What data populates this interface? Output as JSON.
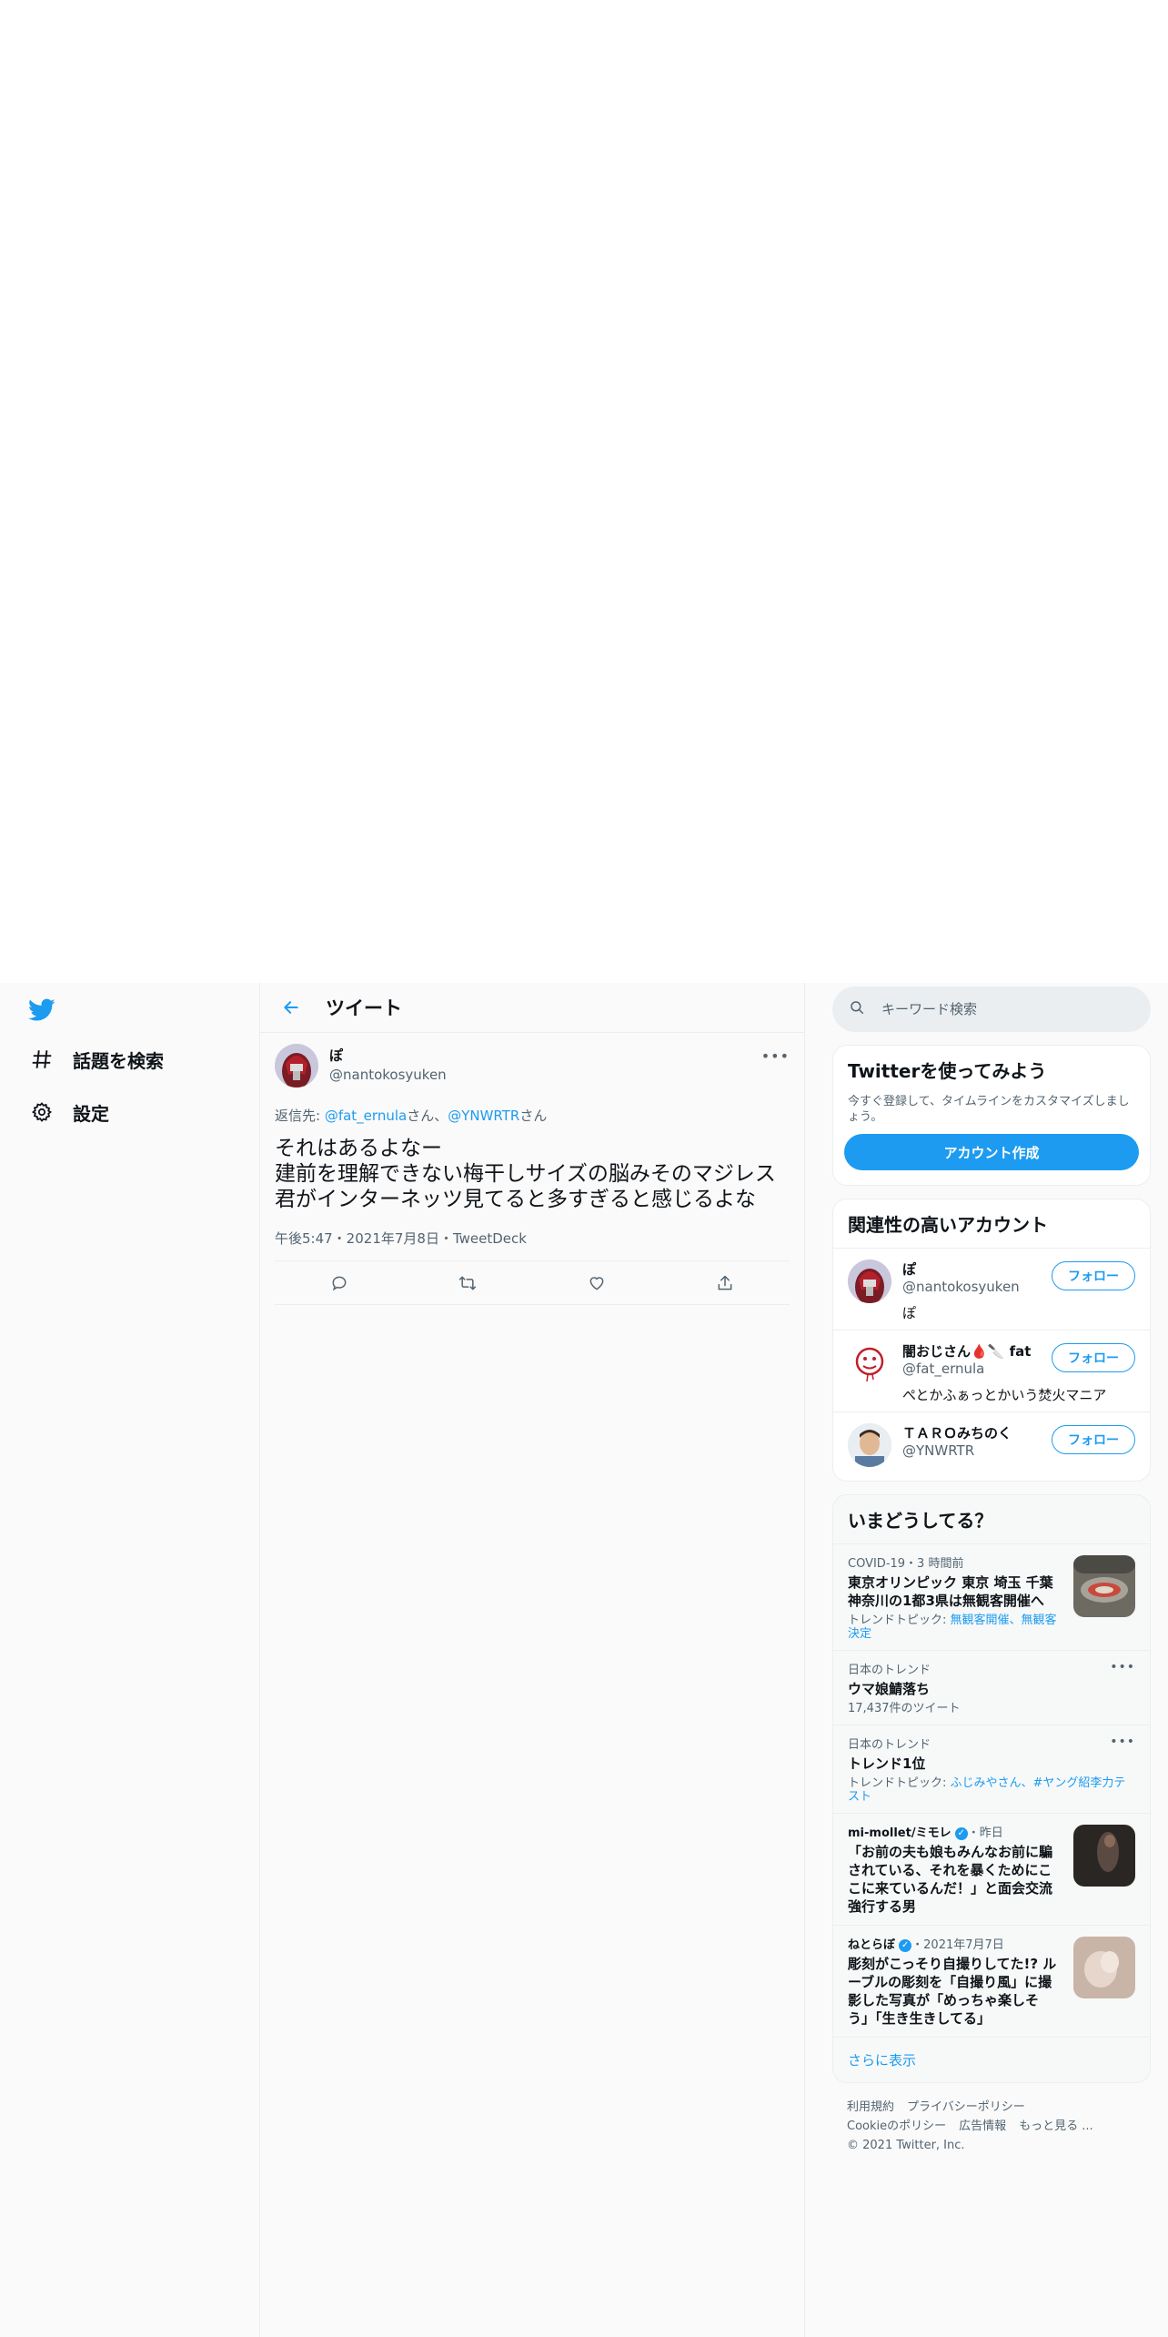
{
  "nav": {
    "explore_label": "話題を検索",
    "settings_label": "設定"
  },
  "header": {
    "title": "ツイート"
  },
  "tweet": {
    "name": "ぽ",
    "handle": "@nantokosyuken",
    "reply_prefix": "返信先: ",
    "reply_user1": "@fat_ernula",
    "reply_sep1": "さん、",
    "reply_user2": "@YNWRTR",
    "reply_sep2": "さん",
    "text": "それはあるよなー\n建前を理解できない梅干しサイズの脳みそのマジレス君がインターネッツ見てると多すぎると感じるよな",
    "meta": "午後5:47・2021年7月8日・TweetDeck"
  },
  "search": {
    "placeholder": "キーワード検索"
  },
  "signup": {
    "title": "Twitterを使ってみよう",
    "description": "今すぐ登録して、タイムラインをカスタマイズしましょう。",
    "button": "アカウント作成"
  },
  "related": {
    "title": "関連性の高いアカウント",
    "follow_label": "フォロー",
    "accounts": [
      {
        "name": "ぽ",
        "handle": "@nantokosyuken",
        "bio": "ぽ"
      },
      {
        "name": "闇おじさん🩸🔪 fat",
        "handle": "@fat_ernula",
        "bio": "ぺとかふぁっとかいう焚火マニア"
      },
      {
        "name": "ＴＡＲＯみちのく",
        "handle": "@YNWRTR",
        "bio": ""
      }
    ]
  },
  "trends": {
    "title": "いまどうしてる？",
    "items": [
      {
        "context": "COVID-19・3 時間前",
        "title": "東京オリンピック 東京 埼玉 千葉 神奈川の1都3県は無観客開催へ",
        "sub_prefix": "トレンドトピック: ",
        "sub_links": "無観客開催、無観客決定"
      },
      {
        "context": "日本のトレンド",
        "title": "ウマ娘鯖落ち",
        "sub": "17,437件のツイート"
      },
      {
        "context": "日本のトレンド",
        "title": "トレンド1位",
        "sub_prefix": "トレンドトピック: ",
        "sub_links": "ふじみやさん、#ヤング紹李力テスト"
      },
      {
        "source": "mi-mollet/ミモレ",
        "time": "・昨日",
        "title": "「お前の夫も娘もみんなお前に騙されている、それを暴くためにここに来ているんだ！」と面会交流強行する男"
      },
      {
        "source": "ねとらぼ",
        "time": "・2021年7月7日",
        "title": "彫刻がこっそり自撮りしてた!? ルーブルの彫刻を「自撮り風」に撮影した写真が「めっちゃ楽しそう」「生き生きしてる」"
      }
    ],
    "show_more": "さらに表示"
  },
  "footer": {
    "terms": "利用規約",
    "privacy": "プライバシーポリシー",
    "cookies": "Cookieのポリシー",
    "ads": "広告情報",
    "more": "もっと見る ...",
    "copyright": "© 2021 Twitter, Inc."
  },
  "colors": {
    "accent": "#1d9bf0",
    "text": "#0f1419",
    "muted": "#536471",
    "border": "#ebeef0"
  }
}
